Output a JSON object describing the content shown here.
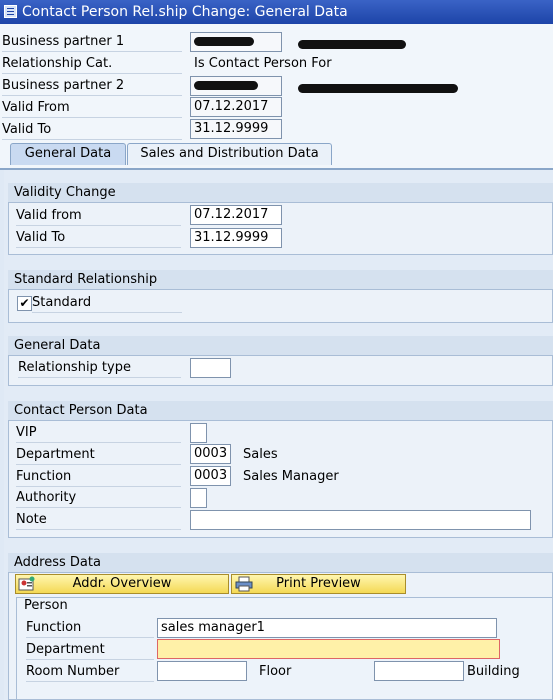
{
  "window": {
    "title": "Contact Person Rel.ship Change: General Data"
  },
  "header": {
    "business_partner_1_label": "Business partner 1",
    "relationship_cat_label": "Relationship Cat.",
    "relationship_cat_value": "Is Contact Person For",
    "business_partner_2_label": "Business partner 2",
    "valid_from_label": "Valid From",
    "valid_from_value": "07.12.2017",
    "valid_to_label": "Valid To",
    "valid_to_value": "31.12.9999"
  },
  "tabs": [
    {
      "label": "General Data",
      "active": true
    },
    {
      "label": "Sales and Distribution Data",
      "active": false
    }
  ],
  "validity_change": {
    "title": "Validity Change",
    "valid_from_label": "Valid from",
    "valid_from_value": "07.12.2017",
    "valid_to_label": "Valid To",
    "valid_to_value": "31.12.9999"
  },
  "standard_relationship": {
    "title": "Standard Relationship",
    "standard_label": "Standard",
    "standard_checked": true
  },
  "general_data": {
    "title": "General Data",
    "relationship_type_label": "Relationship type",
    "relationship_type_value": ""
  },
  "contact_person_data": {
    "title": "Contact Person Data",
    "vip_label": "VIP",
    "department_label": "Department",
    "department_code": "0003",
    "department_text": "Sales",
    "function_label": "Function",
    "function_code": "0003",
    "function_text": "Sales Manager",
    "authority_label": "Authority",
    "note_label": "Note",
    "note_value": ""
  },
  "address_data": {
    "title": "Address Data",
    "addr_overview_label": "Addr. Overview",
    "print_preview_label": "Print Preview",
    "person": {
      "title": "Person",
      "function_label": "Function",
      "function_value": "sales manager1",
      "department_label": "Department",
      "department_value": "",
      "room_number_label": "Room Number",
      "room_number_value": "",
      "floor_label": "Floor",
      "floor_value": "",
      "building_label": "Building"
    }
  },
  "colors": {
    "title_bar": "#1d44a8",
    "highlight_field": "#fff1a8",
    "button": "#f4d955"
  }
}
